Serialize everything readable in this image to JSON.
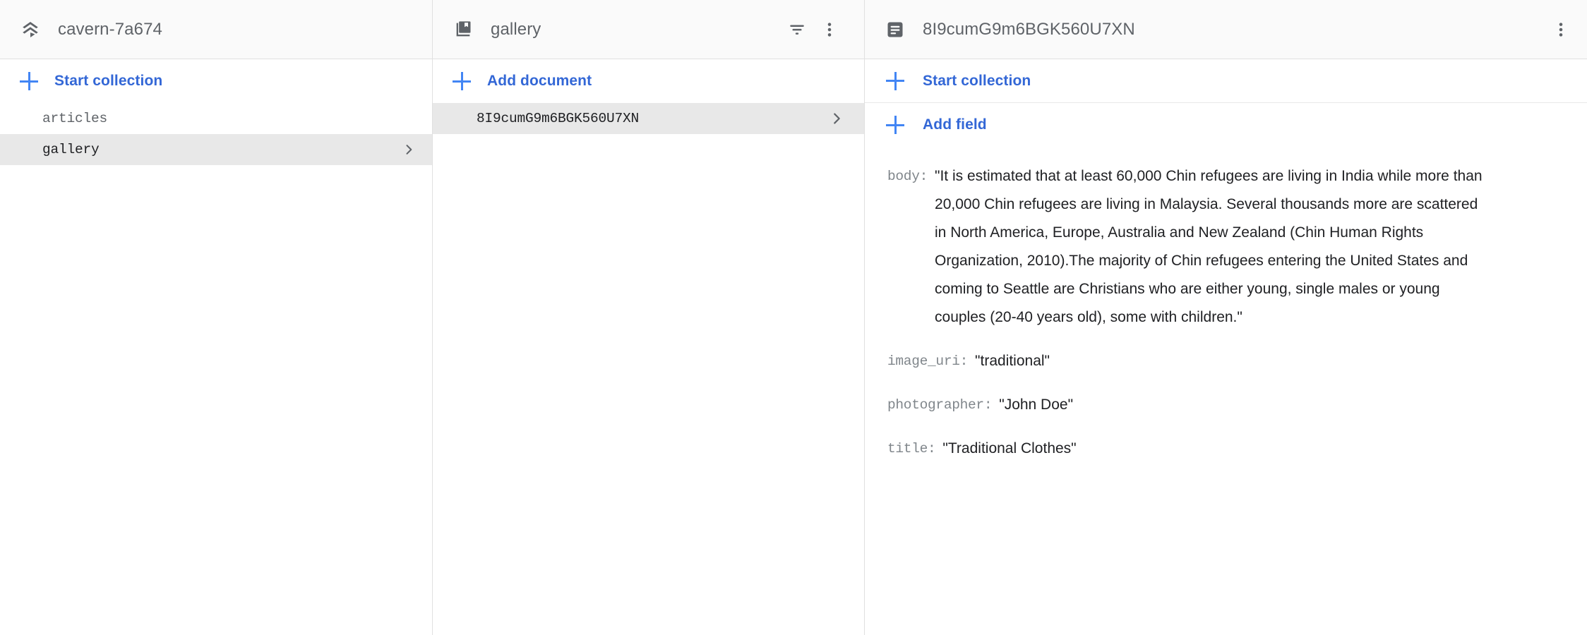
{
  "app": {
    "accent_blue": "#3367d6",
    "plus_blue": "#4285f4",
    "header_bg": "#fafafa",
    "selected_bg": "#e8e8e8",
    "text_gray": "#5f6368",
    "text_dark": "#202124"
  },
  "left_panel": {
    "header": {
      "icon": "database-stack-icon",
      "title": "cavern-7a674"
    },
    "start_collection_label": "Start collection",
    "collections": [
      {
        "label": "articles",
        "selected": false
      },
      {
        "label": "gallery",
        "selected": true
      }
    ]
  },
  "middle_panel": {
    "header": {
      "icon": "collection-books-icon",
      "title": "gallery",
      "filter_icon": "filter-list-icon",
      "menu_icon": "more-vert-icon"
    },
    "add_document_label": "Add document",
    "documents": [
      {
        "label": "8I9cumG9m6BGK560U7XN",
        "selected": true
      }
    ]
  },
  "right_panel": {
    "header": {
      "icon": "document-icon",
      "title": "8I9cumG9m6BGK560U7XN",
      "menu_icon": "more-vert-icon"
    },
    "start_collection_label": "Start collection",
    "add_field_label": "Add field",
    "fields": [
      {
        "key": "body",
        "value": "\"It is estimated that at least 60,000 Chin refugees are living in India while more than 20,000 Chin refugees are living in Malaysia. Several thousands more are scattered in North America, Europe, Australia and New Zealand (Chin Human Rights Organization, 2010).The majority of Chin refugees entering the United States and coming to Seattle are Christians who are either young, single males or young couples (20-40 years old), some with children.\""
      },
      {
        "key": "image_uri",
        "value": "\"traditional\""
      },
      {
        "key": "photographer",
        "value": "\"John Doe\""
      },
      {
        "key": "title",
        "value": "\"Traditional Clothes\""
      }
    ]
  }
}
